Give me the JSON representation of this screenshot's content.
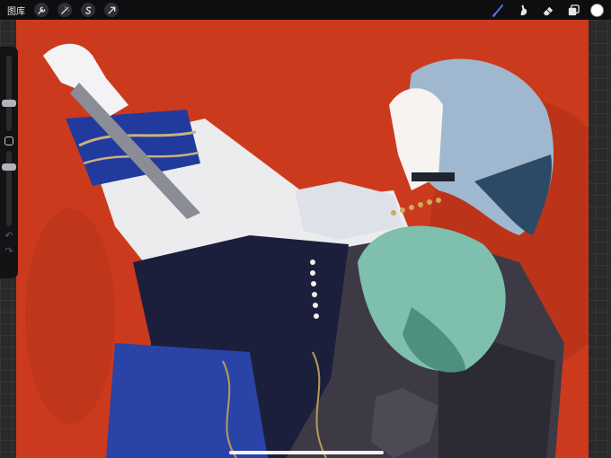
{
  "app": {
    "gallery_label": "图库",
    "tools_left": [
      {
        "name": "actions-icon"
      },
      {
        "name": "adjustments-icon"
      },
      {
        "name": "selection-icon"
      },
      {
        "name": "transform-icon"
      }
    ],
    "tools_right": [
      {
        "name": "brush-icon",
        "active": true
      },
      {
        "name": "smudge-icon"
      },
      {
        "name": "eraser-icon"
      },
      {
        "name": "layers-icon"
      }
    ],
    "current_color": "#ffffff",
    "accent_color": "#4a78f5"
  },
  "sidebar": {
    "brush_size_level": 0.35,
    "opacity_level": 0.82
  },
  "artwork": {
    "background_color": "#cc3a1e"
  }
}
